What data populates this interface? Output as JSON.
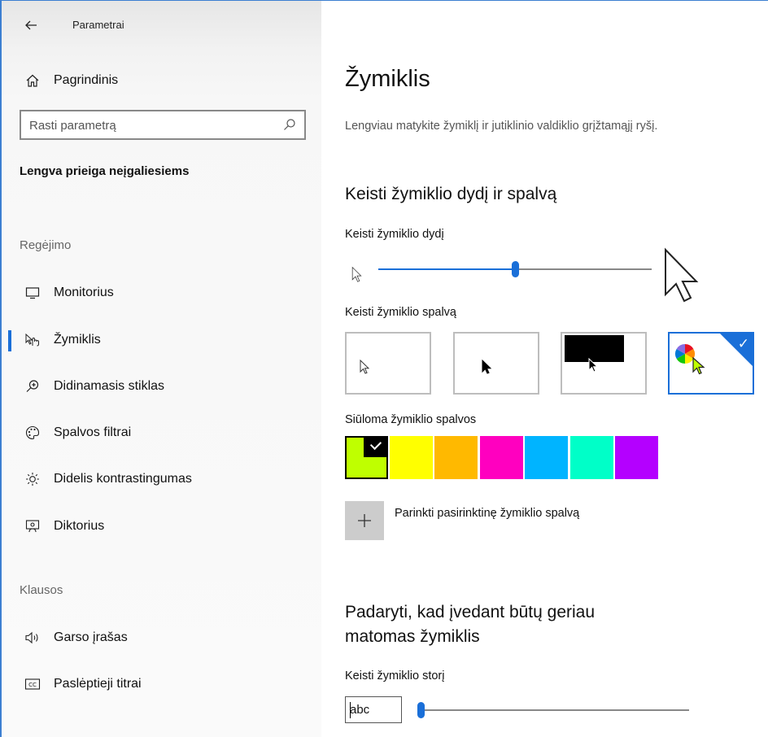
{
  "window": {
    "title": "Parametrai"
  },
  "sidebar": {
    "back_icon": "arrow-left-icon",
    "home": {
      "label": "Pagrindinis",
      "icon": "home-icon"
    },
    "search": {
      "placeholder": "Rasti parametrą",
      "icon": "search-icon"
    },
    "section_title": "Lengva prieiga neįgaliesiems",
    "groups": [
      {
        "heading": "Regėjimo",
        "items": [
          {
            "label": "Monitorius",
            "icon": "monitor-icon",
            "active": false
          },
          {
            "label": "Žymiklis",
            "icon": "pointer-hand-icon",
            "active": true
          },
          {
            "label": "Didinamasis stiklas",
            "icon": "magnifier-icon",
            "active": false
          },
          {
            "label": "Spalvos filtrai",
            "icon": "palette-icon",
            "active": false
          },
          {
            "label": "Didelis kontrastingumas",
            "icon": "sun-icon",
            "active": false
          },
          {
            "label": "Diktorius",
            "icon": "narrator-icon",
            "active": false
          }
        ]
      },
      {
        "heading": "Klausos",
        "items": [
          {
            "label": "Garso įrašas",
            "icon": "speaker-icon",
            "active": false
          },
          {
            "label": "Paslėptieji titrai",
            "icon": "cc-icon",
            "active": false
          }
        ]
      }
    ]
  },
  "main": {
    "title": "Žymiklis",
    "description": "Lengviau matykite žymiklį ir jutiklinio valdiklio grįžtamąjį ryšį.",
    "size_color_section": {
      "heading": "Keisti žymiklio dydį ir spalvą",
      "size_label": "Keisti žymiklio dydį",
      "size_value": 0.5,
      "color_label": "Keisti žymiklio spalvą",
      "color_options": [
        {
          "name": "white",
          "selected": false
        },
        {
          "name": "black",
          "selected": false
        },
        {
          "name": "inverted",
          "selected": false
        },
        {
          "name": "custom",
          "selected": true
        }
      ],
      "suggested_label": "Siūloma žymiklio spalvos",
      "suggested_colors": [
        "#bfff00",
        "#ffff00",
        "#ffb900",
        "#ff00bf",
        "#00b4ff",
        "#00ffc8",
        "#b400ff"
      ],
      "suggested_selected_index": 0,
      "custom_color_label": "Parinkti pasirinktinę žymiklio spalvą",
      "custom_color_icon": "plus-icon"
    },
    "typing_section": {
      "heading": "Padaryti, kad įvedant būtų geriau matomas žymiklis",
      "thickness_label": "Keisti žymiklio storį",
      "preview_text": "abc",
      "thickness_value": 0.0
    }
  }
}
